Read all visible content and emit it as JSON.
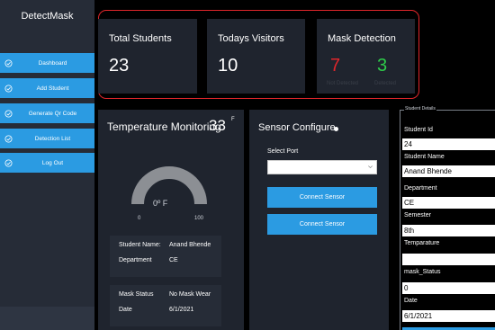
{
  "app": {
    "title": "DetectMask"
  },
  "sidebar": {
    "items": [
      {
        "label": "Dashboard"
      },
      {
        "label": "Add Student"
      },
      {
        "label": "Generate Qr Code"
      },
      {
        "label": "Detection List"
      },
      {
        "label": "Log Out"
      }
    ]
  },
  "stats": {
    "total_students": {
      "title": "Total Students",
      "value": "23"
    },
    "todays_visitors": {
      "title": "Todays Visitors",
      "value": "10"
    },
    "mask_detection": {
      "title": "Mask Detection",
      "not_detected": "7",
      "detected": "3",
      "not_detected_label": "Not Detected",
      "detected_label": "Detected",
      "not_detected_color": "#e0262b",
      "detected_color": "#2ecc4a"
    }
  },
  "temperature": {
    "title": "Temperature Monitoring",
    "value": "33",
    "unit_superscript": "F",
    "gauge_reading": "0º F",
    "gauge_min": "0",
    "gauge_max": "100",
    "student_name_label": "Student Name:",
    "student_name": "Anand Bhende",
    "department_label": "Department",
    "department": "CE",
    "mask_status_label": "Mask Status",
    "mask_status": "No Mask Wear",
    "date_label": "Date",
    "date": "6/1/2021"
  },
  "sensor": {
    "title": "Sensor Configure",
    "select_port_label": "Select Port",
    "port_value": "",
    "buttons": [
      "Connect Sensor",
      "Connect Sensor"
    ]
  },
  "details": {
    "legend": "Student Details",
    "fields": [
      {
        "label": "Student Id",
        "value": "24"
      },
      {
        "label": "Student Name",
        "value": "Anand Bhende"
      },
      {
        "label": "Department",
        "value": "CE"
      },
      {
        "label": "Semester",
        "value": "8th"
      },
      {
        "label": "Temparature",
        "value": ""
      },
      {
        "label": "mask_Status",
        "value": "0"
      },
      {
        "label": "Date",
        "value": "6/1/2021"
      }
    ]
  },
  "colors": {
    "accent": "#2b9be2",
    "frame_highlight": "#e0262b"
  }
}
